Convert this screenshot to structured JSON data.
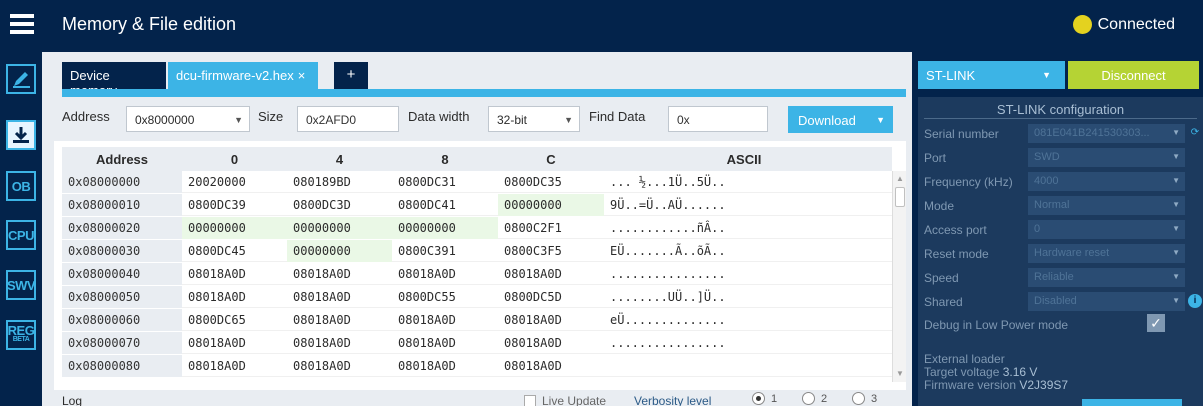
{
  "header": {
    "title": "Memory & File edition",
    "connection_status": "Connected",
    "status_color": "#e4d21f"
  },
  "rail": {
    "items": [
      {
        "id": "erase-program",
        "icon": "pencil-icon"
      },
      {
        "id": "download",
        "icon": "download-icon"
      },
      {
        "id": "ob",
        "label": "OB"
      },
      {
        "id": "cpu",
        "label": "CPU"
      },
      {
        "id": "swv",
        "label": "SWV"
      },
      {
        "id": "reg",
        "label": "REG",
        "badge": "BETA"
      }
    ]
  },
  "tabs": [
    {
      "label": "Device memory"
    },
    {
      "label": "dcu-firmware-v2.hex",
      "close": "×"
    },
    {
      "label": "+"
    }
  ],
  "toolbar": {
    "address_label": "Address",
    "address_value": "0x8000000",
    "size_label": "Size",
    "size_value": "0x2AFD0",
    "width_label": "Data width",
    "width_value": "32-bit",
    "find_label": "Find Data",
    "find_value": "0x",
    "download_label": "Download"
  },
  "table": {
    "headers": [
      "Address",
      "0",
      "4",
      "8",
      "C",
      "ASCII"
    ],
    "rows": [
      {
        "addr": "0x08000000",
        "c0": "20020000",
        "c4": "080189BD",
        "c8": "0800DC31",
        "cc": "0800DC35",
        "ascii": "... ½...1Ü..5Ü.."
      },
      {
        "addr": "0x08000010",
        "c0": "0800DC39",
        "c4": "0800DC3D",
        "c8": "0800DC41",
        "cc": "00000000",
        "ascii": "9Ü..=Ü..AÜ......"
      },
      {
        "addr": "0x08000020",
        "c0": "00000000",
        "c4": "00000000",
        "c8": "00000000",
        "cc": "0800C2F1",
        "ascii": "............ñÂ.."
      },
      {
        "addr": "0x08000030",
        "c0": "0800DC45",
        "c4": "00000000",
        "c8": "0800C391",
        "cc": "0800C3F5",
        "ascii": "EÜ.......Ã..õÃ.."
      },
      {
        "addr": "0x08000040",
        "c0": "08018A0D",
        "c4": "08018A0D",
        "c8": "08018A0D",
        "cc": "08018A0D",
        "ascii": "................"
      },
      {
        "addr": "0x08000050",
        "c0": "08018A0D",
        "c4": "08018A0D",
        "c8": "0800DC55",
        "cc": "0800DC5D",
        "ascii": "........UÜ..]Ü.."
      },
      {
        "addr": "0x08000060",
        "c0": "0800DC65",
        "c4": "08018A0D",
        "c8": "08018A0D",
        "cc": "08018A0D",
        "ascii": "eÜ.............."
      },
      {
        "addr": "0x08000070",
        "c0": "08018A0D",
        "c4": "08018A0D",
        "c8": "08018A0D",
        "cc": "08018A0D",
        "ascii": "................"
      },
      {
        "addr": "0x08000080",
        "c0": "08018A0D",
        "c4": "08018A0D",
        "c8": "08018A0D",
        "cc": "08018A0D",
        "ascii": ""
      }
    ]
  },
  "log": {
    "label": "Log",
    "live_update": "Live Update",
    "verbosity": "Verbosity level",
    "levels": [
      "1",
      "2",
      "3"
    ]
  },
  "right": {
    "probe": "ST-LINK",
    "disconnect": "Disconnect",
    "config_title": "ST-LINK configuration",
    "fields": [
      {
        "label": "Serial number",
        "value": "081E041B241530303..."
      },
      {
        "label": "Port",
        "value": "SWD"
      },
      {
        "label": "Frequency (kHz)",
        "value": "4000"
      },
      {
        "label": "Mode",
        "value": "Normal"
      },
      {
        "label": "Access port",
        "value": "0"
      },
      {
        "label": "Reset mode",
        "value": "Hardware reset"
      },
      {
        "label": "Speed",
        "value": "Reliable"
      },
      {
        "label": "Shared",
        "value": "Disabled"
      }
    ],
    "debug_lp": "Debug in Low Power mode",
    "external_loader": "External loader",
    "target_voltage_label": "Target voltage",
    "target_voltage": "3.16 V",
    "fw_label": "Firmware version",
    "fw_value": "V2J39S7"
  }
}
